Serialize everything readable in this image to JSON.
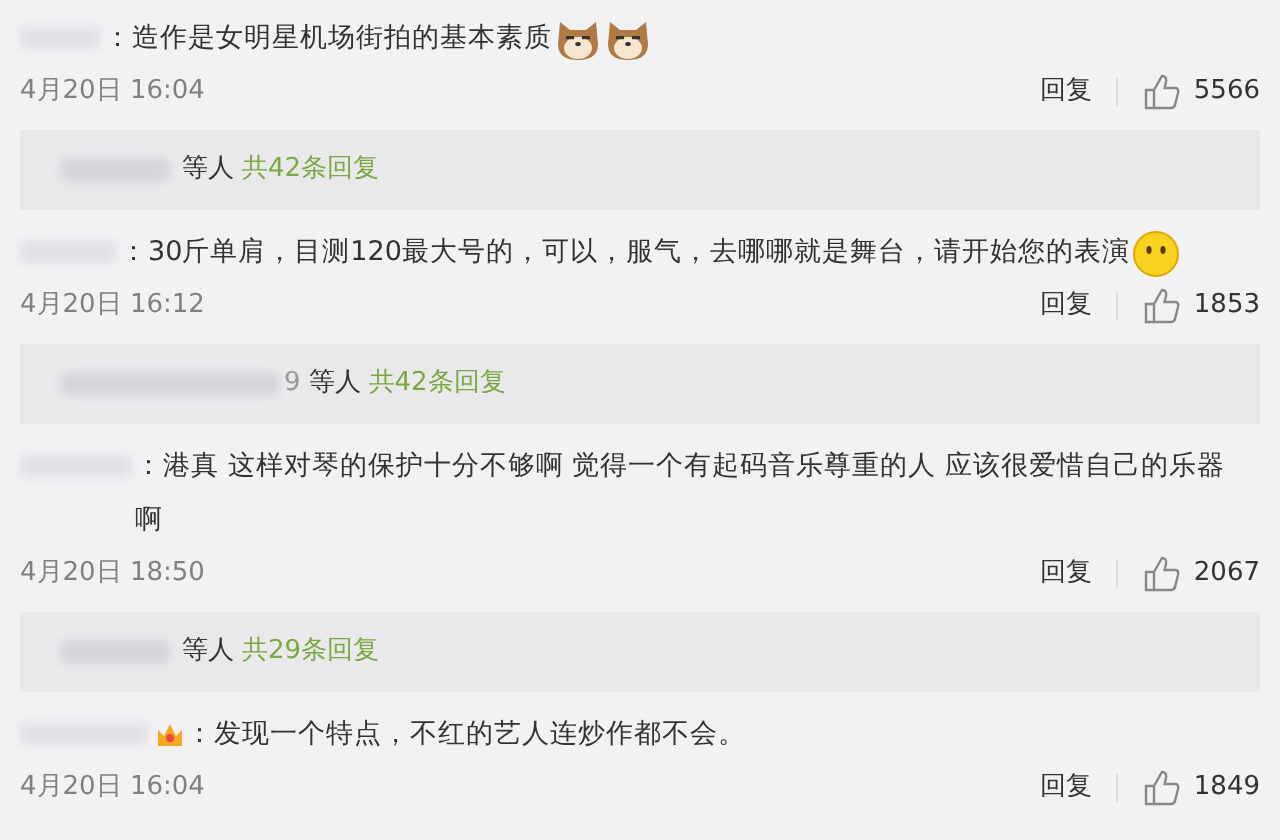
{
  "comments": [
    {
      "text": "：造作是女明星机场街拍的基本素质",
      "emojis": [
        {
          "kind": "dog"
        },
        {
          "kind": "dog"
        }
      ],
      "time": "4月20日 16:04",
      "reply_label": "回复",
      "likes": "5566",
      "replies": {
        "others": "等人",
        "count": "共42条回复"
      }
    },
    {
      "text": "：30斤单肩，目测120最大号的，可以，服气，去哪哪就是舞台，请开始您的表演",
      "emojis": [
        {
          "kind": "smile"
        }
      ],
      "time": "4月20日 16:12",
      "reply_label": "回复",
      "likes": "1853",
      "replies": {
        "name_tail": "9",
        "others": "等人",
        "count": "共42条回复"
      }
    },
    {
      "text": "：港真 这样对琴的保护十分不够啊 觉得一个有起码音乐尊重的人 应该很爱惜自己的乐器啊",
      "time": "4月20日 18:50",
      "reply_label": "回复",
      "likes": "2067",
      "replies": {
        "others": "等人",
        "count": "共29条回复"
      }
    },
    {
      "text": "：发现一个特点，不红的艺人连炒作都不会。",
      "badge": true,
      "time": "4月20日 16:04",
      "reply_label": "回复",
      "likes": "1849"
    }
  ]
}
